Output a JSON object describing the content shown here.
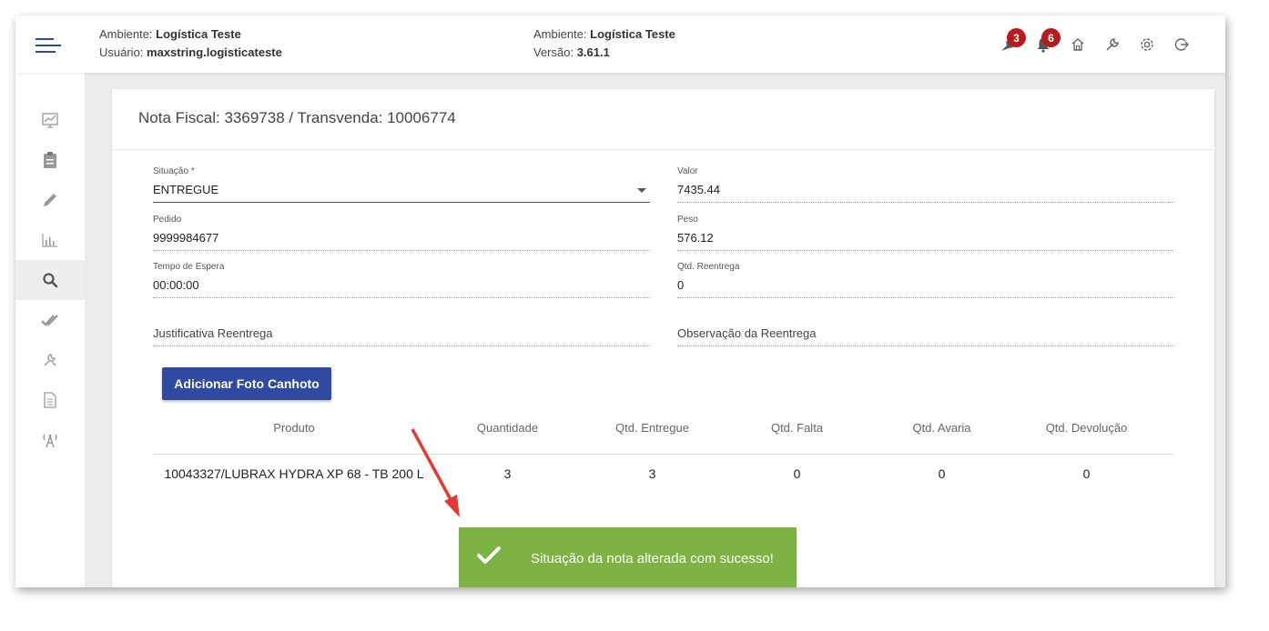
{
  "header": {
    "left": {
      "env_label": "Ambiente: ",
      "env_value": "Logística Teste",
      "user_label": "Usuário: ",
      "user_value": "maxstring.logisticateste"
    },
    "center": {
      "env_label": "Ambiente: ",
      "env_value": "Logística Teste",
      "version_label": "Versão: ",
      "version_value": "3.61.1"
    },
    "icons": [
      {
        "name": "bird-icon",
        "badge": "3"
      },
      {
        "name": "bell-icon",
        "badge": "6"
      },
      {
        "name": "home-icon"
      },
      {
        "name": "wrench-icon"
      },
      {
        "name": "gear-icon"
      },
      {
        "name": "logout-icon"
      }
    ]
  },
  "sidebar": {
    "items": [
      {
        "name": "chart-board-icon"
      },
      {
        "name": "clipboard-icon"
      },
      {
        "name": "pencil-icon"
      },
      {
        "name": "bar-chart-icon"
      },
      {
        "name": "search-icon",
        "active": true
      },
      {
        "name": "double-check-icon"
      },
      {
        "name": "tools-icon"
      },
      {
        "name": "document-icon"
      },
      {
        "name": "antenna-icon"
      }
    ]
  },
  "page": {
    "title": "Nota Fiscal: 3369738 / Transvenda: 10006774"
  },
  "form": {
    "situacao": {
      "label": "Situação *",
      "value": "ENTREGUE"
    },
    "valor": {
      "label": "Valor",
      "value": "7435.44"
    },
    "pedido": {
      "label": "Pedido",
      "value": "9999984677"
    },
    "peso": {
      "label": "Peso",
      "value": "576.12"
    },
    "tempo_espera": {
      "label": "Tempo de Espera",
      "value": "00:00:00"
    },
    "qtd_reentrega": {
      "label": "Qtd. Reentrega",
      "value": "0"
    },
    "justificativa": {
      "label": "Justificativa Reentrega",
      "value": ""
    },
    "observacao": {
      "label": "Observação da Reentrega",
      "value": ""
    }
  },
  "add_photo_button": "Adicionar Foto Canhoto",
  "table": {
    "headers": [
      "Produto",
      "Quantidade",
      "Qtd. Entregue",
      "Qtd. Falta",
      "Qtd. Avaria",
      "Qtd. Devolução"
    ],
    "rows": [
      [
        "10043327/LUBRAX HYDRA XP 68 - TB 200 L",
        "3",
        "3",
        "0",
        "0",
        "0"
      ]
    ]
  },
  "toast": {
    "message": "Situação da nota alterada com sucesso!",
    "icon": "check-icon",
    "color": "#7cb342"
  },
  "colors": {
    "primary": "#2f4aa0",
    "badge": "#b71c1c",
    "annotation_arrow": "#e53935"
  }
}
